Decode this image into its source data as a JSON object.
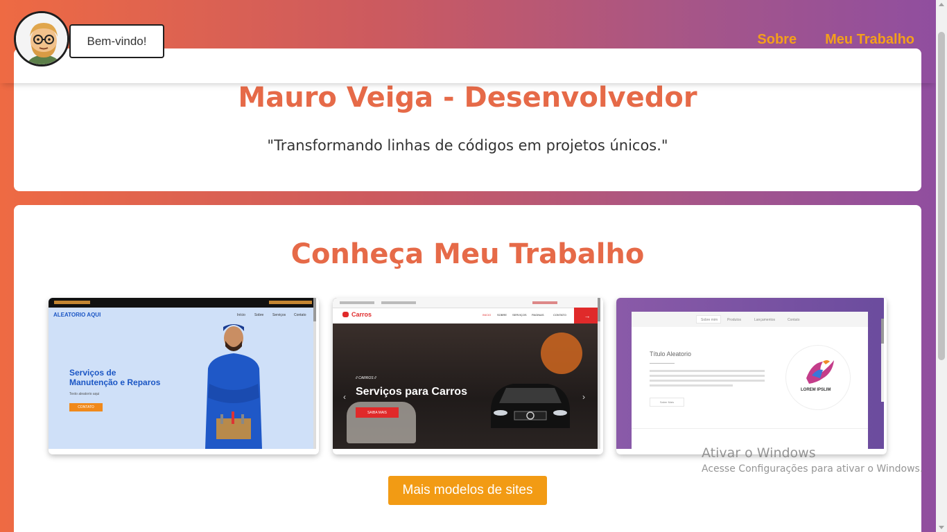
{
  "header": {
    "welcome": "Bem-vindo!",
    "nav": [
      "Sobre",
      "Meu Trabalho"
    ]
  },
  "hero": {
    "title": "Mauro Veiga - Desenvolvedor",
    "subtitle": "\"Transformando linhas de códigos em projetos únicos.\""
  },
  "work": {
    "title": "Conheça Meu Trabalho",
    "more_button": "Mais modelos de sites",
    "cards": [
      {
        "brand": "ALEATORIO AQUI",
        "menu": [
          "Início",
          "Sobre",
          "Serviços",
          "Contato"
        ],
        "headline_1": "Serviços de",
        "headline_2": "Manutenção e Reparos",
        "caption": "Texto aleatorio aqui",
        "button": "CONTATO"
      },
      {
        "brand": "Carros",
        "menu": [
          "INICIO",
          "SOBRE",
          "SERVIÇOS",
          "PAGINAS",
          "CONTATO"
        ],
        "kicker": "// CARROS //",
        "headline": "Serviços para Carros",
        "button": "SAIBA MAIS"
      },
      {
        "tabs": [
          "Sobre mim",
          "Produtos",
          "Lançamentos",
          "Contato"
        ],
        "headline": "Título Aleatorio",
        "button": "Saber Mais",
        "logo_text": "LOREM IPSLIM"
      }
    ]
  },
  "watermark": {
    "line1": "Ativar o Windows",
    "line2": "Acesse Configurações para ativar o Windows."
  },
  "colors": {
    "accent": "#e66a48",
    "nav": "#f4a01b",
    "button": "#f29b14"
  }
}
